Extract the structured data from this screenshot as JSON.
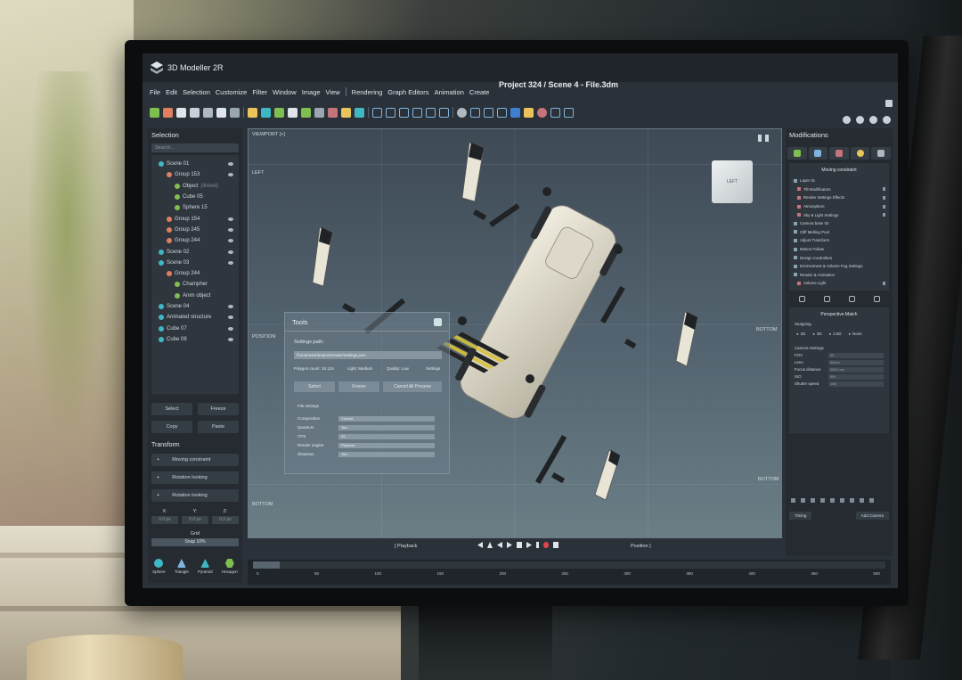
{
  "app": {
    "name": "3D Modeller 2R",
    "document_title": "Project 324 / Scene 4 - File.3dm"
  },
  "menu": [
    "File",
    "Edit",
    "Selection",
    "Customize",
    "Filter",
    "Window",
    "Image",
    "View",
    "Rendering",
    "Graph Editors",
    "Animation",
    "Create"
  ],
  "selection_panel": {
    "title": "Selection",
    "search_placeholder": "Search...",
    "tree": [
      {
        "label": "Scene 01",
        "level": 0,
        "color": "#3fb8c6",
        "eye": true
      },
      {
        "label": "Group 153",
        "level": 1,
        "color": "#e07f5f",
        "eye": true
      },
      {
        "label": "Object",
        "suffix": "(linked)",
        "level": 2,
        "color": "#7fbf4f",
        "eye": false
      },
      {
        "label": "Cube 05",
        "level": 2,
        "color": "#7fbf4f",
        "eye": false
      },
      {
        "label": "Sphere 15",
        "level": 2,
        "color": "#7fbf4f",
        "eye": false
      },
      {
        "label": "Group 154",
        "level": 1,
        "color": "#e07f5f",
        "eye": true
      },
      {
        "label": "Group 245",
        "level": 1,
        "color": "#e07f5f",
        "eye": true
      },
      {
        "label": "Group 244",
        "level": 1,
        "color": "#e07f5f",
        "eye": true
      },
      {
        "label": "Scene 02",
        "level": 0,
        "color": "#3fb8c6",
        "eye": true
      },
      {
        "label": "Scene 03",
        "level": 0,
        "color": "#3fb8c6",
        "eye": true
      },
      {
        "label": "Group 244",
        "level": 1,
        "color": "#e07f5f",
        "eye": false
      },
      {
        "label": "Champher",
        "level": 2,
        "color": "#7fbf4f",
        "eye": false
      },
      {
        "label": "Anim object",
        "level": 2,
        "color": "#7fbf4f",
        "eye": false
      },
      {
        "label": "Scene 04",
        "level": 0,
        "color": "#3fb8c6",
        "eye": true
      },
      {
        "label": "Animated structure",
        "level": 0,
        "color": "#3fb8c6",
        "eye": true
      },
      {
        "label": "Cube 07",
        "level": 0,
        "color": "#3fb8c6",
        "eye": true
      },
      {
        "label": "Cube 08",
        "level": 0,
        "color": "#3fb8c6",
        "eye": true
      }
    ],
    "buttons": [
      "Select",
      "Freeze",
      "Copy",
      "Paste"
    ],
    "transform": {
      "title": "Transform",
      "items": [
        "Moving constraint",
        "Rotation looking",
        "Rotation looking"
      ]
    },
    "axes": {
      "x": "X:",
      "y": "Y:",
      "z": "Z:",
      "x_val": "0.0 px",
      "y_val": "0.0 px",
      "z_val": "0.0 px"
    },
    "grid_label": "Grid",
    "snap_value": "Snap 10%",
    "primitives": [
      "Sphere",
      "Triangle",
      "Pyramid",
      "Hexagon"
    ]
  },
  "viewport": {
    "label": "VIEWPORT [+]",
    "left_label": "LEFT",
    "position_label": "POSITION",
    "bottom_label": "BOTTOM",
    "right_bottom_label": "BOTTOM",
    "right_side_label": "BOTTOM",
    "viewcube_face": "LEFT"
  },
  "tools_dialog": {
    "title": "Tools",
    "settings_path_label": "Settings path:",
    "path_value": "/home/user/project/render/settings.json",
    "stats": [
      "Polygon count: 15 124",
      "Light: Medium",
      "Quality: Low",
      "Settings"
    ],
    "buttons": [
      "Select",
      "Freeze",
      "Cancel All Process"
    ],
    "file_section": "File settings",
    "fields": [
      {
        "label": "Composition",
        "value": "Current"
      },
      {
        "label": "Quantum",
        "value": "Yes"
      },
      {
        "label": "CPS",
        "value": "25"
      },
      {
        "label": "Render engine",
        "value": "Physical"
      },
      {
        "label": "Shadows",
        "value": "Yes"
      }
    ]
  },
  "playback": {
    "label": "[ Playback",
    "position": "Position ]"
  },
  "timeline": {
    "ticks": [
      "0",
      "50",
      "100",
      "150",
      "200",
      "250",
      "300",
      "350",
      "400",
      "450",
      "500"
    ]
  },
  "modifiers_panel": {
    "title": "Modifications",
    "list_header": "Moving constraint",
    "items": [
      {
        "label": "Layer 01",
        "sub": false
      },
      {
        "label": "Tilt Modificators",
        "sub": true
      },
      {
        "label": "Render Settings Effects",
        "sub": true
      },
      {
        "label": "Atmosphere",
        "sub": true
      },
      {
        "label": "Sky & Light Settings",
        "sub": true
      },
      {
        "label": "Camera base 02",
        "sub": false
      },
      {
        "label": "Cliff Melting Pool",
        "sub": false
      },
      {
        "label": "Adjust Transform",
        "sub": false
      },
      {
        "label": "Motion Follow",
        "sub": false
      },
      {
        "label": "Design Controllers",
        "sub": false
      },
      {
        "label": "Environment & Volume Fog Settings",
        "sub": false
      },
      {
        "label": "Render & Animation",
        "sub": false
      },
      {
        "label": "Volume Light",
        "sub": true
      }
    ],
    "match_header": "Perspective Match",
    "snapping_label": "Snapping",
    "snapping_options": [
      "2D",
      "3D",
      "2.5D",
      "None"
    ],
    "camera_label": "Camera Settings",
    "camera_fields": [
      {
        "label": "FOV",
        "value": "45"
      },
      {
        "label": "Lens",
        "value": "50mm"
      },
      {
        "label": "Focus distance",
        "value": "2000 mm"
      },
      {
        "label": "ISO",
        "value": "800"
      },
      {
        "label": "Shutter speed",
        "value": "1/60"
      }
    ],
    "bottom_buttons": [
      "Timing",
      "Add Camera"
    ]
  },
  "colors": {
    "accent": "#3fb8c6",
    "panel": "#252b31",
    "viewport_top": "#3e4a55",
    "record": "#e0474c"
  }
}
